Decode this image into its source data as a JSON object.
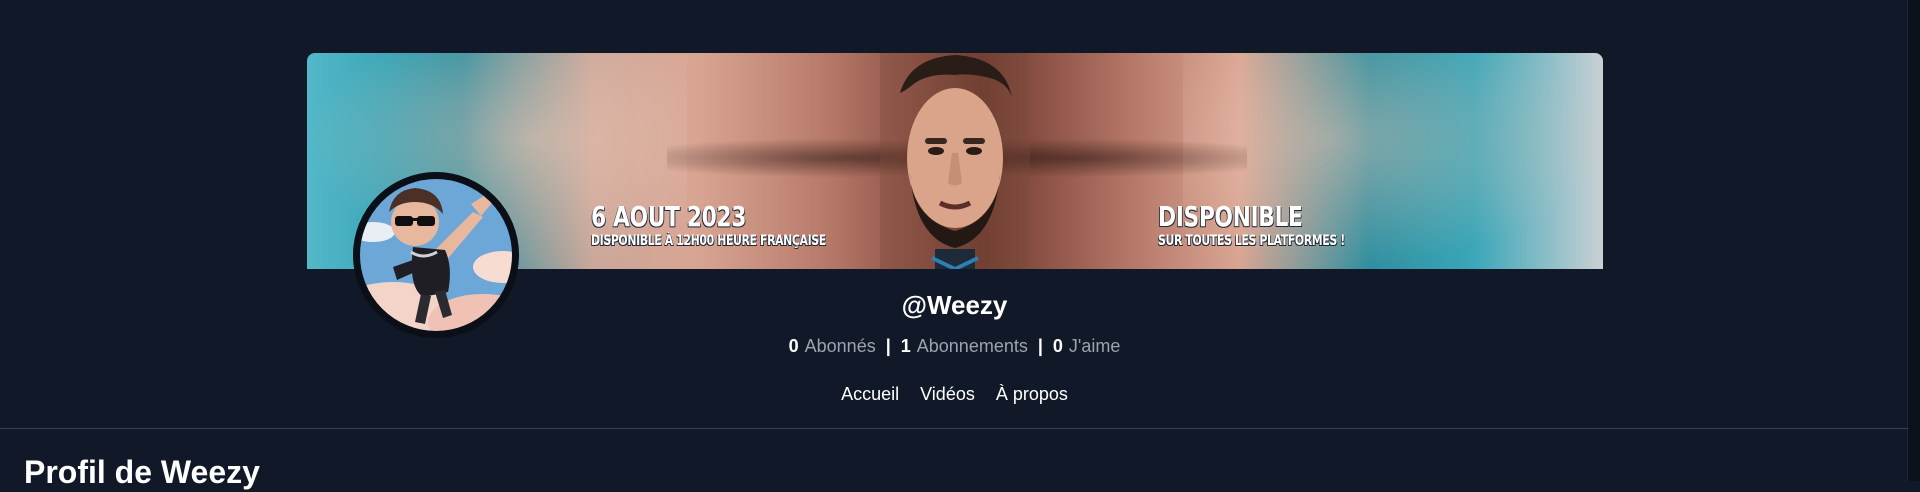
{
  "banner": {
    "date_title": "6 AOUT 2023",
    "date_subtitle": "DISPONIBLE À 12H00 HEURE FRANÇAISE",
    "avail_title": "DISPONIBLE",
    "avail_subtitle": "SUR TOUTES LES  PLATFORMES !"
  },
  "profile": {
    "username": "@Weezy",
    "followers_count": "0",
    "followers_label": "Abonnés",
    "following_count": "1",
    "following_label": "Abonnements",
    "likes_count": "0",
    "likes_label": "J'aime",
    "separator": "|"
  },
  "nav": {
    "items": [
      {
        "label": "Accueil"
      },
      {
        "label": "Vidéos"
      },
      {
        "label": "À propos"
      }
    ]
  },
  "page": {
    "title": "Profil de Weezy"
  },
  "colors": {
    "background": "#111827",
    "muted_text": "#9ca3af",
    "divider": "#374151"
  }
}
